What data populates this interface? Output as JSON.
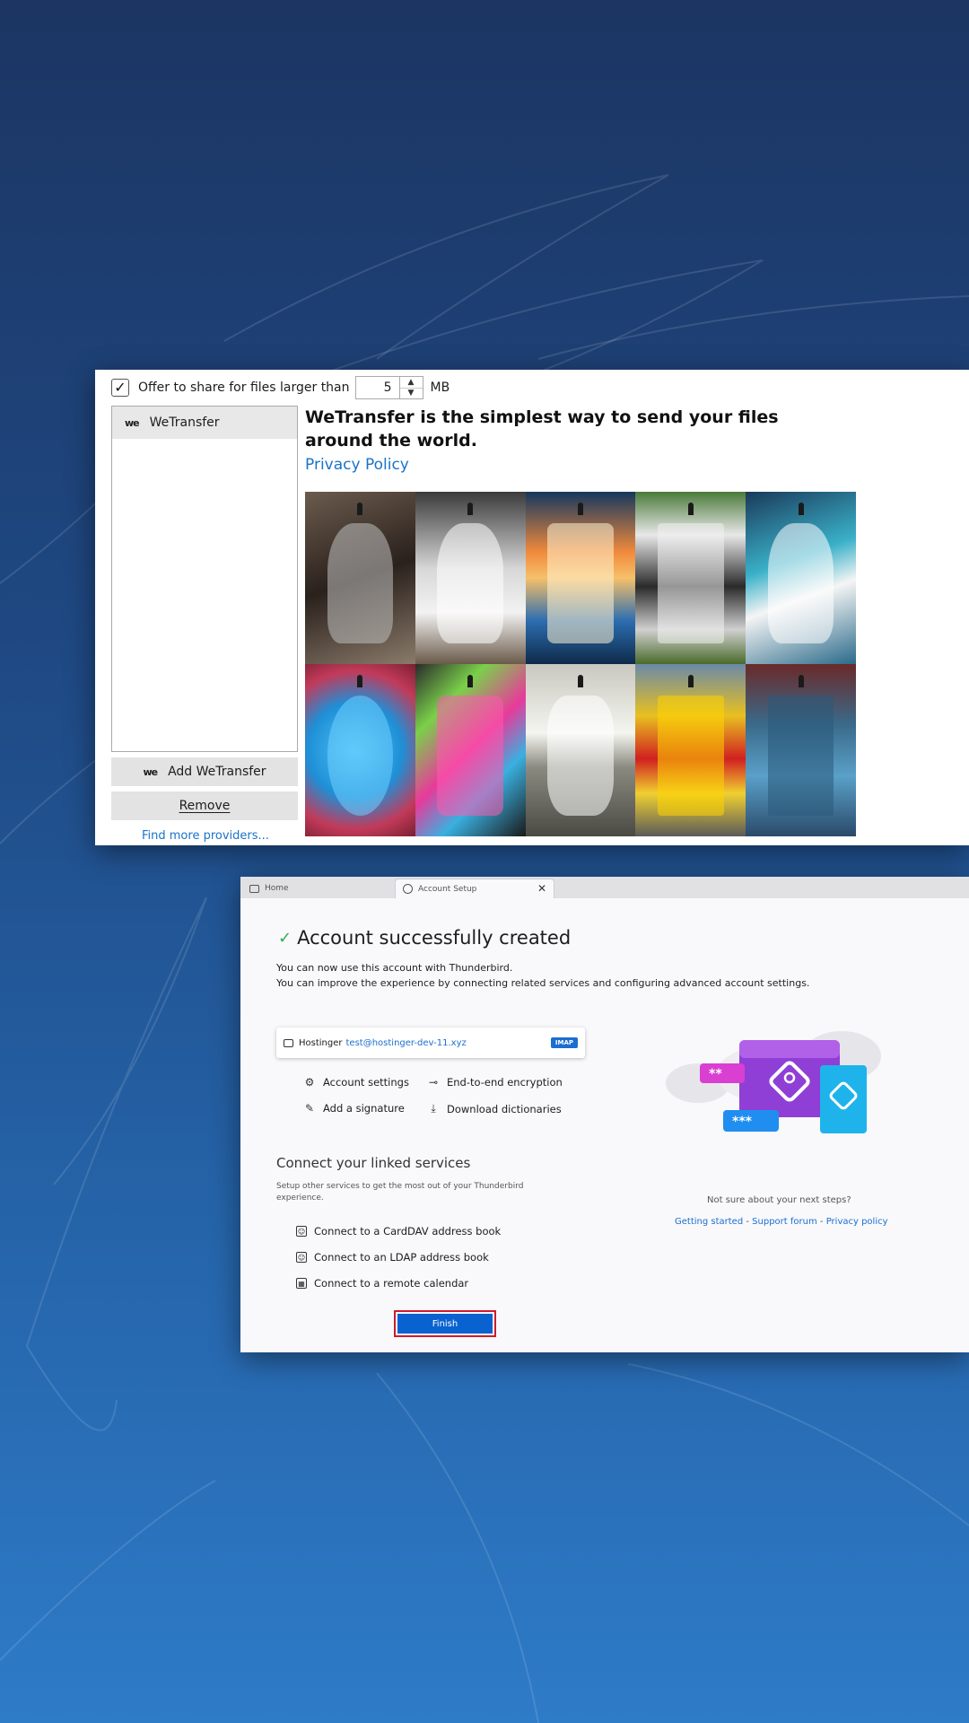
{
  "wetransfer_prefs": {
    "offer_label": "Offer to share for files larger than",
    "offer_checked": true,
    "check_glyph": "✓",
    "size_value": "5",
    "size_unit": "MB",
    "providers": [
      {
        "label": "WeTransfer",
        "icon": "wetransfer-logo"
      }
    ],
    "add_button_label": "Add WeTransfer",
    "remove_button_label": "Remove",
    "find_more_label": "Find more providers...",
    "heading": "WeTransfer is the simplest way to send your files around the world.",
    "privacy_link": "Privacy Policy",
    "gallery_count": 10
  },
  "account_setup": {
    "tabs": [
      {
        "label": "Home",
        "icon": "folder-icon"
      },
      {
        "label": "Account Setup",
        "icon": "globe-icon",
        "active": true
      }
    ],
    "success_title": "Account successfully created",
    "success_desc_1": "You can now use this account with Thunderbird.",
    "success_desc_2": "You can improve the experience by connecting related services and configuring advanced account settings.",
    "account": {
      "provider": "Hostinger",
      "email": "test@hostinger-dev-11.xyz",
      "badge": "IMAP"
    },
    "actions": {
      "account_settings": "Account settings",
      "encryption": "End-to-end encryption",
      "signature": "Add a signature",
      "dictionaries": "Download dictionaries"
    },
    "linked_title": "Connect your linked services",
    "linked_desc": "Setup other services to get the most out of your Thunderbird experience.",
    "services": [
      "Connect to a CardDAV address book",
      "Connect to an LDAP address book",
      "Connect to a remote calendar"
    ],
    "finish_label": "Finish",
    "help_question": "Not sure about your next steps?",
    "help_links": [
      "Getting started",
      "Support forum",
      "Privacy policy"
    ],
    "illustration_password": "***",
    "illustration_password_short": "**"
  },
  "colors": {
    "accent": "#0a62d0",
    "link": "#1a73c8",
    "success": "#2bb24c",
    "highlight_border": "#d11a2a"
  }
}
